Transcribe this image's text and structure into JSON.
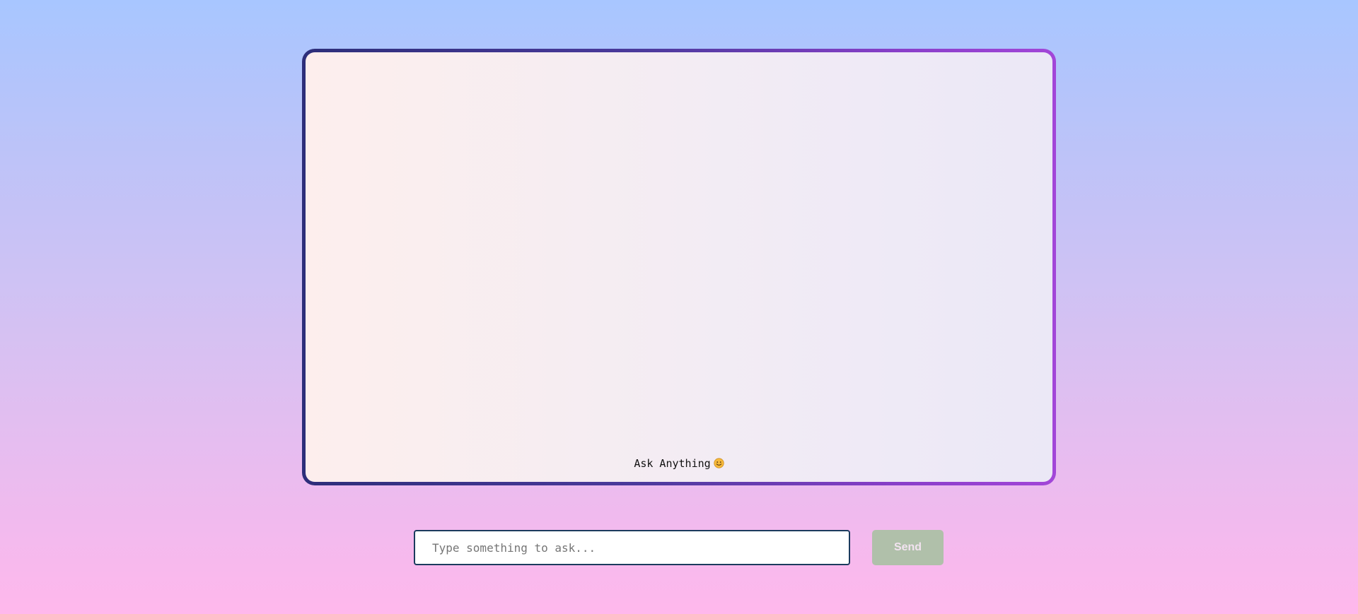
{
  "chat": {
    "welcome_text": "Ask Anything",
    "welcome_icon": "smiley-face-icon"
  },
  "composer": {
    "placeholder": "Type something to ask...",
    "value": "",
    "send_label": "Send",
    "send_enabled": false
  },
  "colors": {
    "background_top": "#a8c6ff",
    "background_bottom": "#ffb8ec",
    "frame_border_left": "#2d2e7a",
    "frame_border_right": "#a246d8",
    "input_border": "#1c3b5e",
    "send_button_bg": "#b0c0aa",
    "send_button_text": "#f2e3f0"
  }
}
